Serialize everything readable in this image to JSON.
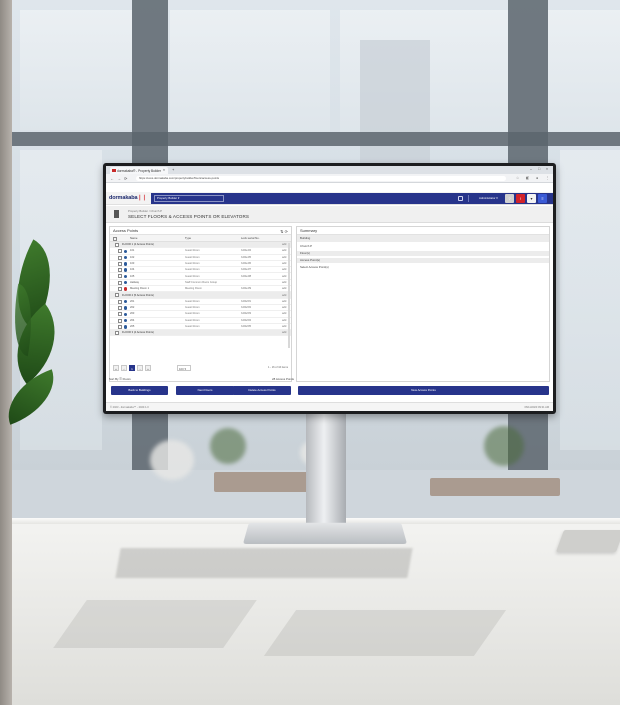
{
  "browser": {
    "tab_title": "dormakaba® - Property Builder",
    "tab_close": "×",
    "new_tab": "+",
    "url": "https://exos.dormakaba.com/propertybuilder/floors/access-points",
    "window_controls": [
      "–",
      "□",
      "×"
    ],
    "nav_icons": [
      "back-icon",
      "forward-icon",
      "reload-icon"
    ]
  },
  "app": {
    "logo_brand": "dorma",
    "logo_brand2": "kaba",
    "logo_mark": "❘❘",
    "site_selector": "Property Builder ▾",
    "user_label": "Administrator ▾",
    "header_buttons": [
      {
        "name": "help-icon",
        "glyph": "?",
        "color": "#d0d0d0"
      },
      {
        "name": "alarm-icon",
        "glyph": "!",
        "color": "#d2232a"
      },
      {
        "name": "filter-icon",
        "glyph": "▾",
        "color": "#f3f3f3"
      },
      {
        "name": "menu-icon",
        "glyph": "≡",
        "color": "#3b5bd6"
      }
    ],
    "breadcrumb": "Property Builder / Church P",
    "page_title": "SELECT FLOORS & ACCESS POINTS OR ELEVATORS"
  },
  "access_points": {
    "title": "Access Points",
    "tools": "⇅  ⟳",
    "columns": {
      "check": "",
      "name": "Name",
      "type": "Type",
      "lock": "Lock serial No.",
      "action": ""
    },
    "rows": [
      {
        "kind": "group",
        "name": "FLOOR 1 (4 Access Points)",
        "type": "",
        "lock": "",
        "action": "add"
      },
      {
        "kind": "item",
        "dot": "blue",
        "name": "101",
        "type": "Guest Room",
        "lock": "b4f4e4f4",
        "action": "add"
      },
      {
        "kind": "item",
        "dot": "blue",
        "name": "102",
        "type": "Guest Room",
        "lock": "b4f4e4f5",
        "action": "add"
      },
      {
        "kind": "item",
        "dot": "blue",
        "name": "103",
        "type": "Guest Room",
        "lock": "b4f4e4f6",
        "action": "add"
      },
      {
        "kind": "item",
        "dot": "blue",
        "name": "104",
        "type": "Guest Room",
        "lock": "b4f4e4f7",
        "action": "add"
      },
      {
        "kind": "item",
        "dot": "blue",
        "name": "105",
        "type": "Guest Room",
        "lock": "b4f4e4f8",
        "action": "add"
      },
      {
        "kind": "item",
        "dot": "blue",
        "name": "Hallway",
        "type": "Staff Common Room Group",
        "lock": "",
        "action": "add"
      },
      {
        "kind": "item",
        "dot": "red",
        "name": "Meeting Room 1",
        "type": "Meeting Room",
        "lock": "b4f4e4f9",
        "action": "add"
      },
      {
        "kind": "group",
        "name": "FLOOR 2 (5 Access Points)",
        "type": "",
        "lock": "",
        "action": "add"
      },
      {
        "kind": "item",
        "dot": "blue",
        "name": "201",
        "type": "Guest Room",
        "lock": "b4f4e5f1",
        "action": "add"
      },
      {
        "kind": "item",
        "dot": "blue",
        "name": "202",
        "type": "Guest Room",
        "lock": "b4f4e5f2",
        "action": "add"
      },
      {
        "kind": "item",
        "dot": "blue",
        "name": "203",
        "type": "Guest Room",
        "lock": "b4f4e5f3",
        "action": "add"
      },
      {
        "kind": "item",
        "dot": "blue",
        "name": "204",
        "type": "Guest Room",
        "lock": "b4f4e5f4",
        "action": "add"
      },
      {
        "kind": "item",
        "dot": "blue",
        "name": "205",
        "type": "Guest Room",
        "lock": "b4f4e5f5",
        "action": "add"
      },
      {
        "kind": "group",
        "name": "FLOOR 3 (4 Access Points)",
        "type": "",
        "lock": "",
        "action": "add"
      }
    ],
    "pager": {
      "first": "«",
      "prev": "‹",
      "current": "1",
      "next": "›",
      "last": "»",
      "page_size": "100 ▾",
      "info": "1 - 16 of 16 items"
    },
    "sort_label": "Sort By ☰  Floors",
    "count_label": "28 Access Points"
  },
  "summary": {
    "title": "Summary",
    "rows": [
      {
        "label": "Building",
        "band": true
      },
      {
        "label": "Church P",
        "band": false
      },
      {
        "label": "Floor(s)",
        "band": true
      },
      {
        "label": "Access Point(s)",
        "band": true
      },
      {
        "label": "Select Access Point(s)",
        "band": false
      }
    ]
  },
  "buttons": {
    "back": "Back to Buildings",
    "next_floors": "Next Floors",
    "delete": "Delete Access Points",
    "new": "New Access Points"
  },
  "status": {
    "left": "© 2023 - dormakaba™ - 2023.1.0",
    "right": "06/11/2023 09:31 AM"
  }
}
